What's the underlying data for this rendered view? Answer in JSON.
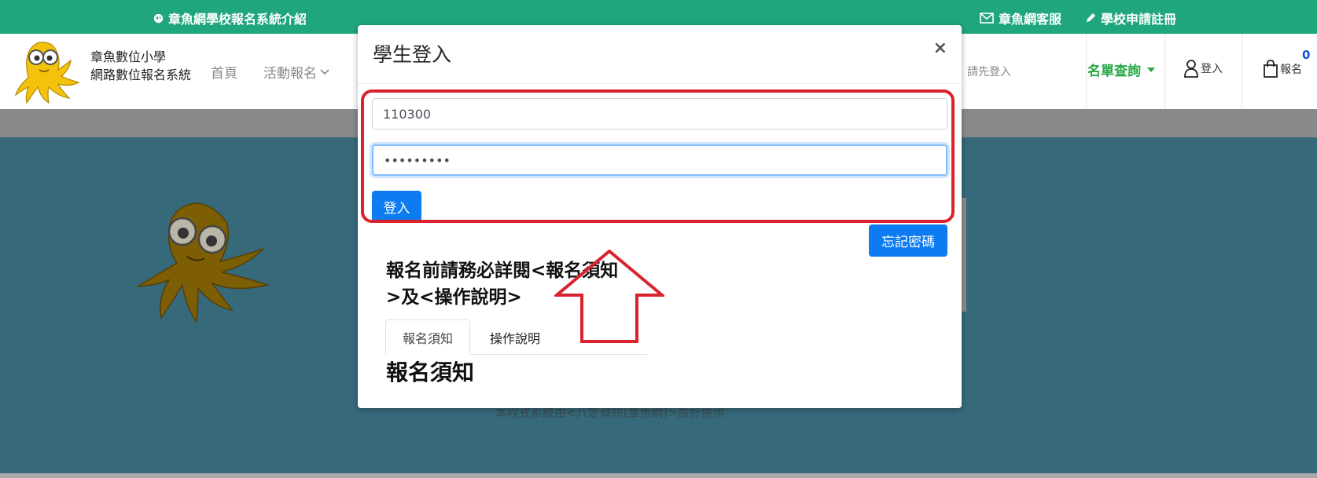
{
  "topbar": {
    "intro": "章魚網學校報名系統介紹",
    "service": "章魚網客服",
    "register": "學校申請註冊"
  },
  "header": {
    "brand_line1": "章魚數位小學",
    "brand_line2": "網路數位報名系統",
    "nav": [
      "首頁",
      "活動報名"
    ],
    "hint": "請先登入",
    "query": "名單查詢",
    "login": "登入",
    "cart": "報名",
    "cart_count": "0"
  },
  "background": {
    "footer_text": "本程式系統由<八定資訊(章魚網)>設計提供"
  },
  "modal": {
    "title": "學生登入",
    "close": "×",
    "username_value": "110300",
    "password_value": "•••••••••",
    "login_button": "登入",
    "forgot_button": "忘記密碼",
    "notice_line1": "報名前請務必詳閱<報名須知",
    "notice_line2": ">及<操作說明>",
    "tabs": [
      "報名須知",
      "操作說明"
    ],
    "section_title": "報名須知"
  },
  "colors": {
    "topbar": "#1fa67e",
    "primary": "#0d7cf2",
    "highlight": "#d9232d",
    "background": "#366a7b",
    "query": "#28a745"
  }
}
